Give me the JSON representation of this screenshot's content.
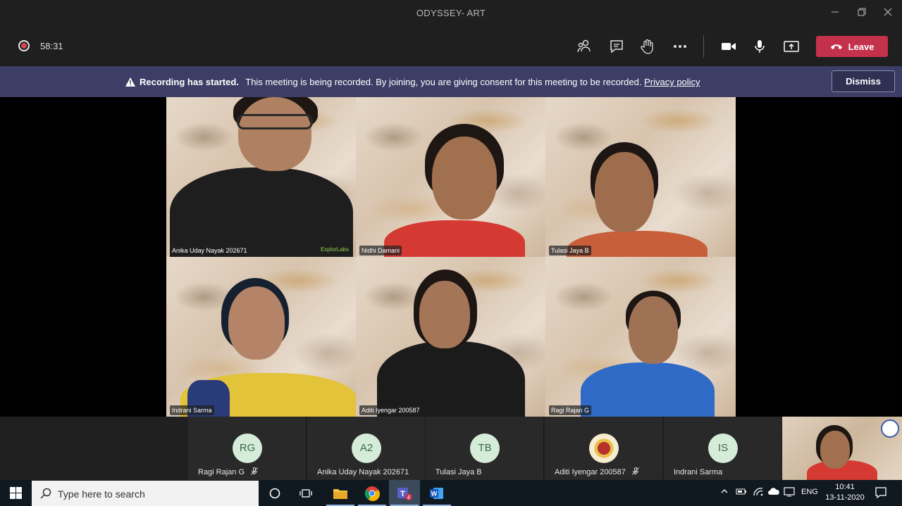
{
  "window": {
    "title": "ODYSSEY- ART"
  },
  "toolbar": {
    "timer": "58:31",
    "leave_label": "Leave",
    "colors": {
      "leave": "#c4314b",
      "record": "#d74654"
    }
  },
  "banner": {
    "title": "Recording has started.",
    "message": "This meeting is being recorded. By joining, you are giving consent for this meeting to be recorded.",
    "policy_link": "Privacy policy",
    "dismiss_label": "Dismiss"
  },
  "video_tiles": [
    {
      "name": "Anika Uday Nayak 202671",
      "logo": "ExplorLabs"
    },
    {
      "name": "Nidhi Damani"
    },
    {
      "name": "Tulasi Jaya B"
    },
    {
      "name": "Indrani Sarma"
    },
    {
      "name": "Aditi Iyengar 200587"
    },
    {
      "name": "Ragi Rajan G"
    }
  ],
  "participants": [
    {
      "initials": "RG",
      "name": "Ragi Rajan G",
      "muted": true
    },
    {
      "initials": "A2",
      "name": "Anika Uday Nayak 202671",
      "muted": false
    },
    {
      "initials": "TB",
      "name": "Tulasi Jaya B",
      "muted": false
    },
    {
      "initials": "",
      "name": "Aditi Iyengar 200587",
      "muted": true
    },
    {
      "initials": "IS",
      "name": "Indrani Sarma",
      "muted": false
    }
  ],
  "taskbar": {
    "search_placeholder": "Type here to search",
    "teams_badge": "4",
    "language": "ENG",
    "time": "10:41",
    "date": "13-11-2020"
  }
}
